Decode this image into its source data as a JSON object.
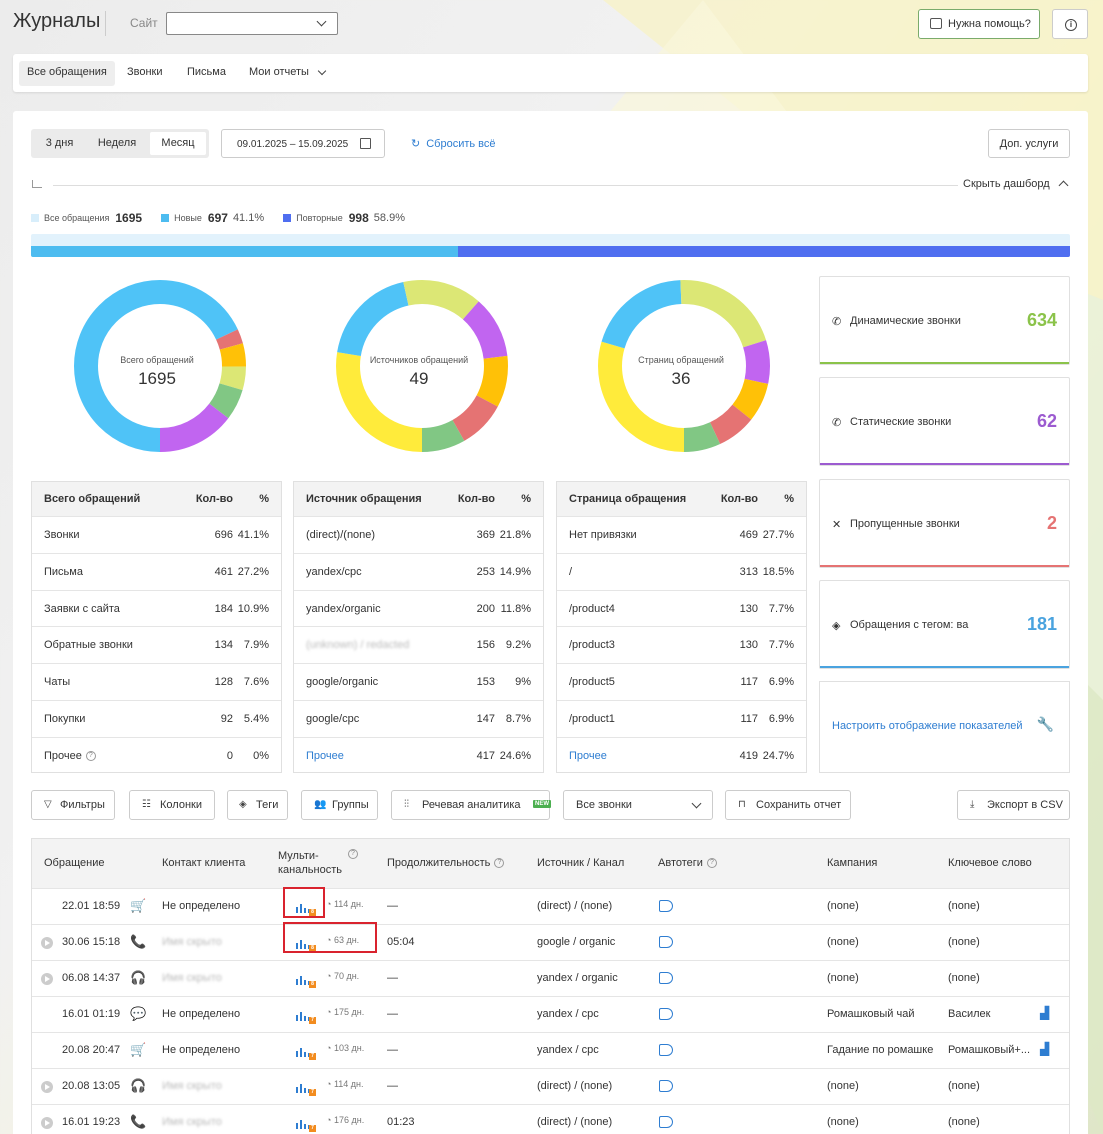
{
  "header": {
    "title": "Журналы",
    "site_label": "Сайт",
    "site_value": "",
    "help_label": "Нужна помощь?"
  },
  "nav": {
    "tabs": [
      "Все обращения",
      "Звонки",
      "Письма",
      "Мои отчеты"
    ]
  },
  "controls": {
    "periods": [
      "3 дня",
      "Неделя",
      "Месяц"
    ],
    "active_period": "Месяц",
    "date_range": "09.01.2025 – 15.09.2025",
    "reset_label": "Сбросить всё",
    "addsvc_label": "Доп. услуги",
    "hide_dash_label": "Скрыть дашборд"
  },
  "summary": {
    "all_label": "Все обращения",
    "all_value": "1695",
    "new_label": "Новые",
    "new_value": "697",
    "new_pct": "41.1%",
    "rep_label": "Повторные",
    "rep_value": "998",
    "rep_pct": "58.9%",
    "new_fraction": 0.411,
    "colors": {
      "all": "#d8eefb",
      "new": "#4dbcf0",
      "rep": "#4f6ef0"
    }
  },
  "donuts": [
    {
      "label": "Всего обращений",
      "value": "1695",
      "segments": [
        {
          "v": 696,
          "c": "#4fc3f7"
        },
        {
          "v": 28,
          "c": "#e57373"
        },
        {
          "v": 45,
          "c": "#ffc107"
        },
        {
          "v": 45,
          "c": "#dce775"
        },
        {
          "v": 60,
          "c": "#81c784"
        },
        {
          "v": 150,
          "c": "#c165f0"
        }
      ]
    },
    {
      "label": "Источников обращений",
      "value": "49",
      "segments": [
        {
          "v": 369,
          "c": "#ffeb3b"
        },
        {
          "v": 253,
          "c": "#4fc3f7"
        },
        {
          "v": 200,
          "c": "#dce775"
        },
        {
          "v": 156,
          "c": "#c165f0"
        },
        {
          "v": 130,
          "c": "#ffc107"
        },
        {
          "v": 120,
          "c": "#e57373"
        },
        {
          "v": 110,
          "c": "#81c784"
        }
      ]
    },
    {
      "label": "Страниц обращений",
      "value": "36",
      "segments": [
        {
          "v": 469,
          "c": "#ffeb3b"
        },
        {
          "v": 313,
          "c": "#4fc3f7"
        },
        {
          "v": 330,
          "c": "#dce775"
        },
        {
          "v": 130,
          "c": "#c165f0"
        },
        {
          "v": 117,
          "c": "#ffc107"
        },
        {
          "v": 117,
          "c": "#e57373"
        },
        {
          "v": 110,
          "c": "#81c784"
        }
      ]
    }
  ],
  "tables": [
    {
      "headers": [
        "Всего обращений",
        "Кол-во",
        "%"
      ],
      "rows": [
        [
          "Звонки",
          "696",
          "41.1%"
        ],
        [
          "Письма",
          "461",
          "27.2%"
        ],
        [
          "Заявки с сайта",
          "184",
          "10.9%"
        ],
        [
          "Обратные звонки",
          "134",
          "7.9%"
        ],
        [
          "Чаты",
          "128",
          "7.6%"
        ],
        [
          "Покупки",
          "92",
          "5.4%"
        ],
        [
          "Прочее",
          "0",
          "0%"
        ]
      ]
    },
    {
      "headers": [
        "Источник обращения",
        "Кол-во",
        "%"
      ],
      "rows": [
        [
          "(direct)/(none)",
          "369",
          "21.8%"
        ],
        [
          "yandex/cpc",
          "253",
          "14.9%"
        ],
        [
          "yandex/organic",
          "200",
          "11.8%"
        ],
        [
          "",
          "156",
          "9.2%"
        ],
        [
          "google/organic",
          "153",
          "9%"
        ],
        [
          "google/cpc",
          "147",
          "8.7%"
        ],
        [
          "Прочее",
          "417",
          "24.6%"
        ]
      ]
    },
    {
      "headers": [
        "Страница обращения",
        "Кол-во",
        "%"
      ],
      "rows": [
        [
          "Нет привязки",
          "469",
          "27.7%"
        ],
        [
          "/",
          "313",
          "18.5%"
        ],
        [
          "/product4",
          "130",
          "7.7%"
        ],
        [
          "/product3",
          "130",
          "7.7%"
        ],
        [
          "/product5",
          "117",
          "6.9%"
        ],
        [
          "/product1",
          "117",
          "6.9%"
        ],
        [
          "Прочее",
          "419",
          "24.7%"
        ]
      ]
    }
  ],
  "cards": [
    {
      "label": "Динамические звонки",
      "value": "634",
      "color": "#8bc34a"
    },
    {
      "label": "Статические звонки",
      "value": "62",
      "color": "#9c5bd0"
    },
    {
      "label": "Пропущенные звонки",
      "value": "2",
      "color": "#e57373"
    },
    {
      "label": "Обращения с тегом: ва",
      "value": "181",
      "color": "#4aa3df"
    }
  ],
  "config_label": "Настроить отображение показателей",
  "toolbar": {
    "filters": "Фильтры",
    "columns": "Колонки",
    "tags": "Теги",
    "groups": "Группы",
    "speech": "Речевая аналитика",
    "new_badge": "NEW",
    "calls_select": "Все звонки",
    "save": "Сохранить отчет",
    "export": "Экспорт в CSV"
  },
  "grid": {
    "headers": {
      "appeal": "Обращение",
      "contact": "Контакт клиента",
      "multi1": "Мульти-",
      "multi2": "канальность",
      "duration": "Продолжительность",
      "source": "Источник / Канал",
      "autotags": "Автотеги",
      "campaign": "Кампания",
      "keyword": "Ключевое слово"
    },
    "rows": [
      {
        "dt": "22.01 18:59",
        "contact": "Не определено",
        "badge": "8",
        "days": "114 дн.",
        "dur": "—",
        "src": "(direct) / (none)",
        "camp": "(none)",
        "kw": "(none)",
        "icon": "cart",
        "play": false,
        "chart": false
      },
      {
        "dt": "30.06 15:18",
        "contact": "",
        "badge": "8",
        "days": "63 дн.",
        "dur": "05:04",
        "src": "google / organic",
        "camp": "(none)",
        "kw": "(none)",
        "icon": "phone",
        "play": true,
        "chart": false
      },
      {
        "dt": "06.08 14:37",
        "contact": "",
        "badge": "8",
        "days": "70 дн.",
        "dur": "—",
        "src": "yandex / organic",
        "camp": "(none)",
        "kw": "(none)",
        "icon": "headset",
        "play": true,
        "chart": false
      },
      {
        "dt": "16.01 01:19",
        "contact": "Не определено",
        "badge": "7",
        "days": "175 дн.",
        "dur": "—",
        "src": "yandex / cpc",
        "camp": "Ромашковый чай",
        "kw": "Василек",
        "icon": "chat",
        "play": false,
        "chart": true
      },
      {
        "dt": "20.08 20:47",
        "contact": "Не определено",
        "badge": "7",
        "days": "103 дн.",
        "dur": "—",
        "src": "yandex / cpc",
        "camp": "Гадание по ромашке",
        "kw": "Ромашковый+...",
        "icon": "cart",
        "play": false,
        "chart": true
      },
      {
        "dt": "20.08 13:05",
        "contact": "",
        "badge": "7",
        "days": "114 дн.",
        "dur": "—",
        "src": "(direct) / (none)",
        "camp": "(none)",
        "kw": "(none)",
        "icon": "headset",
        "play": true,
        "chart": false
      },
      {
        "dt": "16.01 19:23",
        "contact": "",
        "badge": "7",
        "days": "176 дн.",
        "dur": "01:23",
        "src": "(direct) / (none)",
        "camp": "(none)",
        "kw": "(none)",
        "icon": "phone",
        "play": true,
        "chart": false
      }
    ]
  }
}
